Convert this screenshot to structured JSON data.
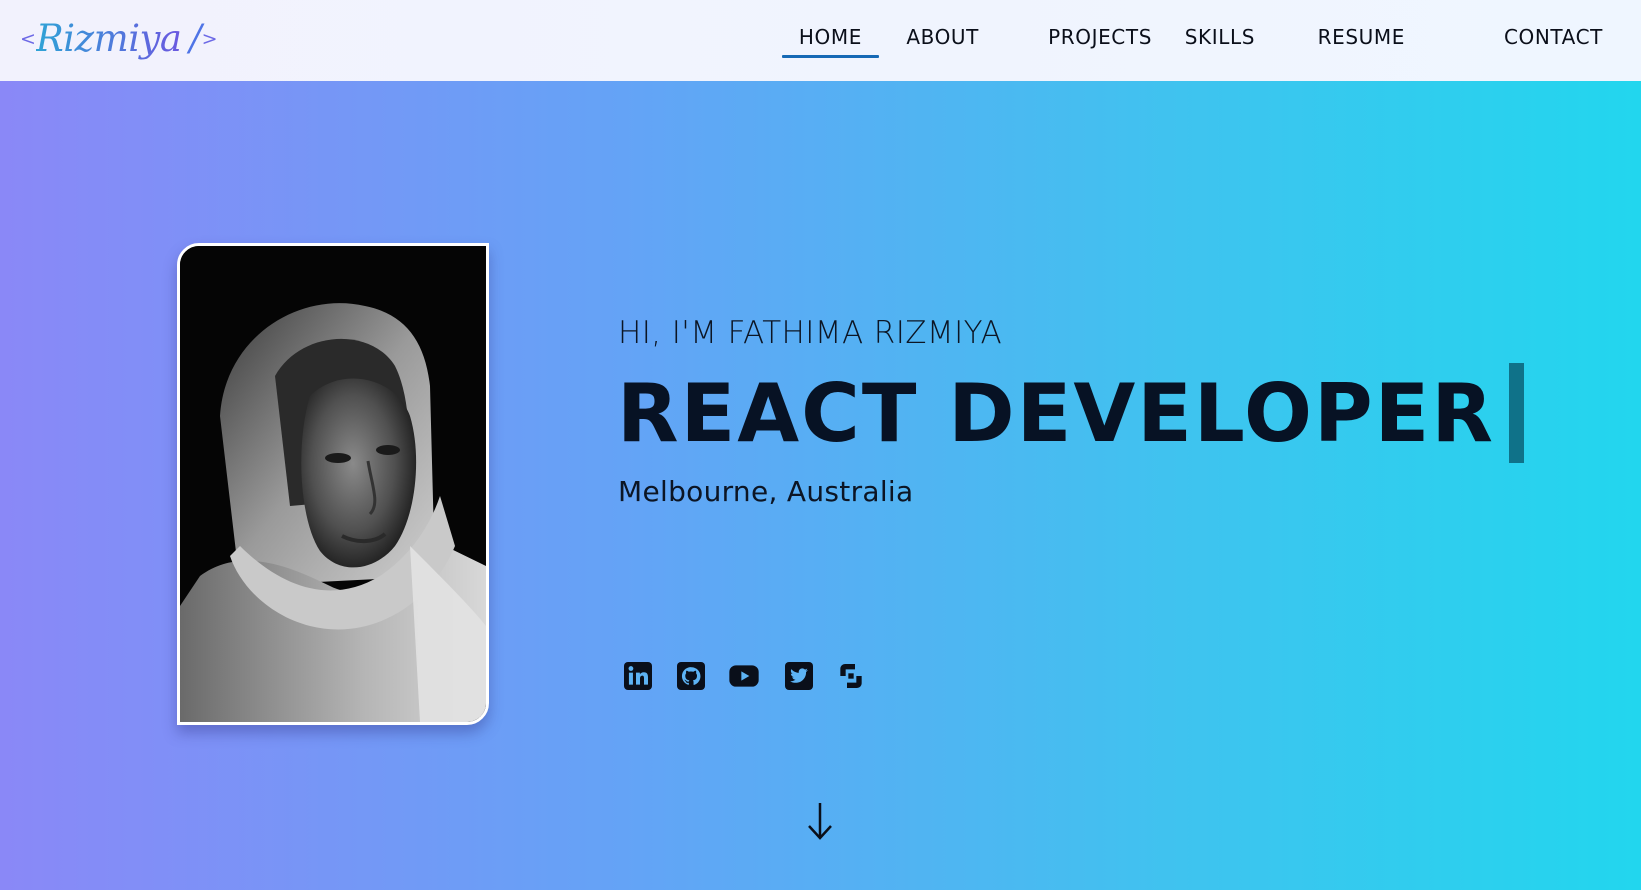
{
  "header": {
    "logo": {
      "open_bracket": "<",
      "name": "Rizmiya",
      "slash": "/",
      "close_bracket": ">"
    },
    "nav": {
      "active": "HOME",
      "items": [
        {
          "label": "HOME"
        },
        {
          "label": "ABOUT"
        },
        {
          "label": "PROJECTS"
        },
        {
          "label": "SKILLS"
        },
        {
          "label": "RESUME"
        },
        {
          "label": "CONTACT"
        }
      ]
    }
  },
  "hero": {
    "greeting": "HI, I'M FATHIMA RIZMIYA",
    "role": "REACT DEVELOPER",
    "location": "Melbourne, Australia",
    "socials": [
      {
        "icon": "linkedin-icon"
      },
      {
        "icon": "github-icon"
      },
      {
        "icon": "youtube-icon"
      },
      {
        "icon": "twitter-icon"
      },
      {
        "icon": "link-icon"
      }
    ],
    "scroll_icon": "arrow-down-icon"
  },
  "colors": {
    "gradient_start": "#8a88f7",
    "gradient_end": "#22d6ee",
    "nav_active_underline": "#1669b5",
    "cursor": "#0f7289",
    "text": "#071224"
  }
}
